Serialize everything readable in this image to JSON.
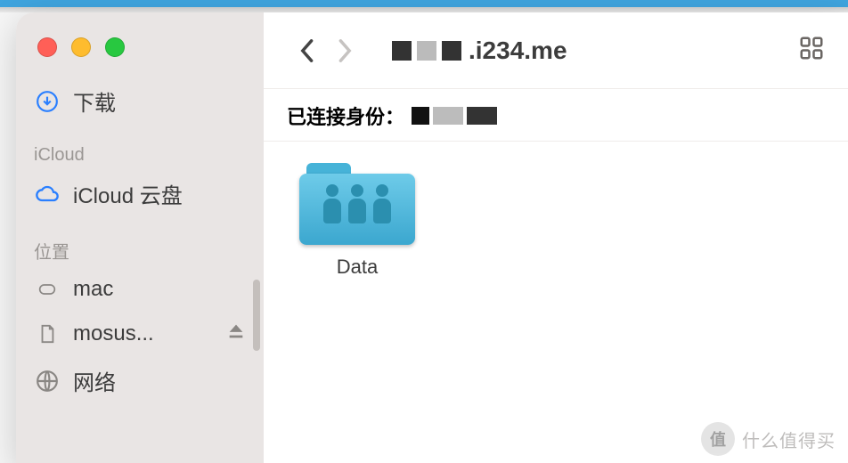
{
  "sidebar": {
    "downloads": {
      "label": "下载",
      "icon": "download-circle-icon"
    },
    "icloud": {
      "header": "iCloud",
      "drive_label": "iCloud 云盘",
      "icon": "cloud-icon"
    },
    "locations": {
      "header": "位置",
      "items": [
        {
          "label": "mac",
          "icon": "disk-icon",
          "ejectable": false
        },
        {
          "label": "mosus...",
          "icon": "document-icon",
          "ejectable": true
        },
        {
          "label": "网络",
          "icon": "globe-icon",
          "ejectable": false
        }
      ]
    }
  },
  "toolbar": {
    "title_visible": ".i234.me"
  },
  "connection": {
    "label": "已连接身份："
  },
  "content": {
    "items": [
      {
        "name": "Data",
        "type": "shared-folder"
      }
    ]
  },
  "watermark": {
    "badge": "值",
    "text": "什么值得买"
  }
}
